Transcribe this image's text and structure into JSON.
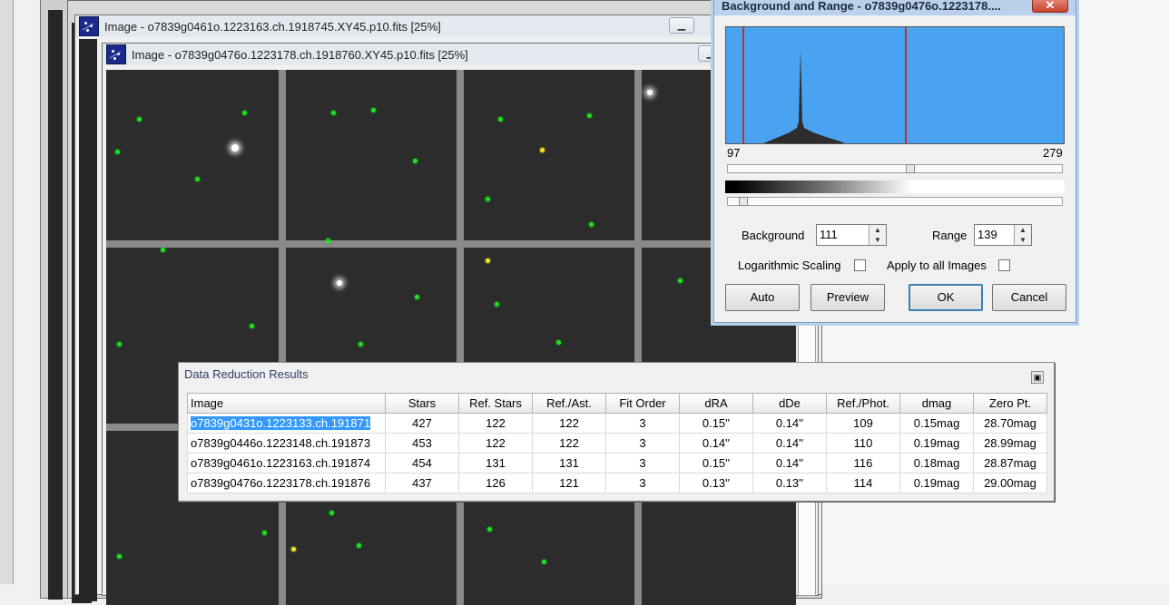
{
  "windows": [
    {
      "title": "Image - o7839g0461o.1223163.ch.1918745.XY45.p10.fits [25%]"
    },
    {
      "title": "Image - o7839g0476o.1223178.ch.1918760.XY45.p10.fits [25%]"
    }
  ],
  "bg_range": {
    "title": "Background and Range - o7839g0476o.1223178....",
    "close_label": "✕",
    "hist_min": "97",
    "hist_max": "279",
    "background_label": "Background",
    "background_value": "111",
    "range_label": "Range",
    "range_value": "139",
    "log_label": "Logarithmic Scaling",
    "apply_label": "Apply to all Images",
    "buttons": {
      "auto": "Auto",
      "preview": "Preview",
      "ok": "OK",
      "cancel": "Cancel"
    },
    "colors": {
      "histogram_bg": "#4aa3f0",
      "range_line": "#c3302b"
    }
  },
  "results": {
    "title": "Data Reduction Results",
    "columns": [
      "Image",
      "Stars",
      "Ref. Stars",
      "Ref./Ast.",
      "Fit Order",
      "dRA",
      "dDe",
      "Ref./Phot.",
      "dmag",
      "Zero Pt."
    ],
    "rows": [
      [
        "o7839g0431o.1223133.ch.191871",
        "427",
        "122",
        "122",
        "3",
        "0.15''",
        "0.14''",
        "109",
        "0.15mag",
        "28.70mag"
      ],
      [
        "o7839g0446o.1223148.ch.191873",
        "453",
        "122",
        "122",
        "3",
        "0.14''",
        "0.14''",
        "110",
        "0.19mag",
        "28.99mag"
      ],
      [
        "o7839g0461o.1223163.ch.191874",
        "454",
        "131",
        "131",
        "3",
        "0.15''",
        "0.14''",
        "116",
        "0.18mag",
        "28.87mag"
      ],
      [
        "o7839g0476o.1223178.ch.191876",
        "437",
        "126",
        "121",
        "3",
        "0.13''",
        "0.13''",
        "114",
        "0.19mag",
        "29.00mag"
      ]
    ]
  }
}
